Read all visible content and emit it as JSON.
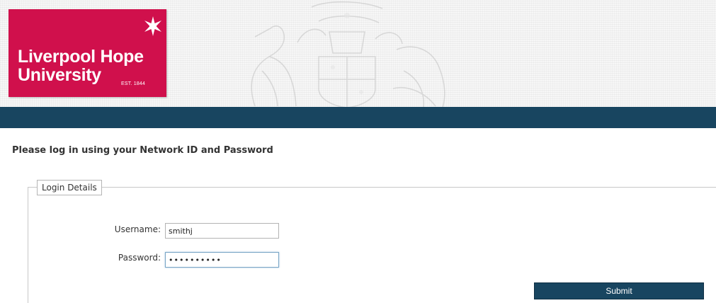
{
  "header": {
    "logo": {
      "line1": "Liverpool Hope",
      "line2": "University",
      "est": "EST. 1844",
      "brand_color": "#d0104c",
      "icon": "star-icon"
    },
    "crest_icon": "university-crest-watermark",
    "navbar_color": "#184560"
  },
  "main": {
    "instruction": "Please log in using your Network ID and Password",
    "fieldset_legend": "Login Details",
    "username": {
      "label": "Username:",
      "value": "smithj"
    },
    "password": {
      "label": "Password:",
      "value": "••••••••••"
    },
    "submit_label": "Submit"
  }
}
